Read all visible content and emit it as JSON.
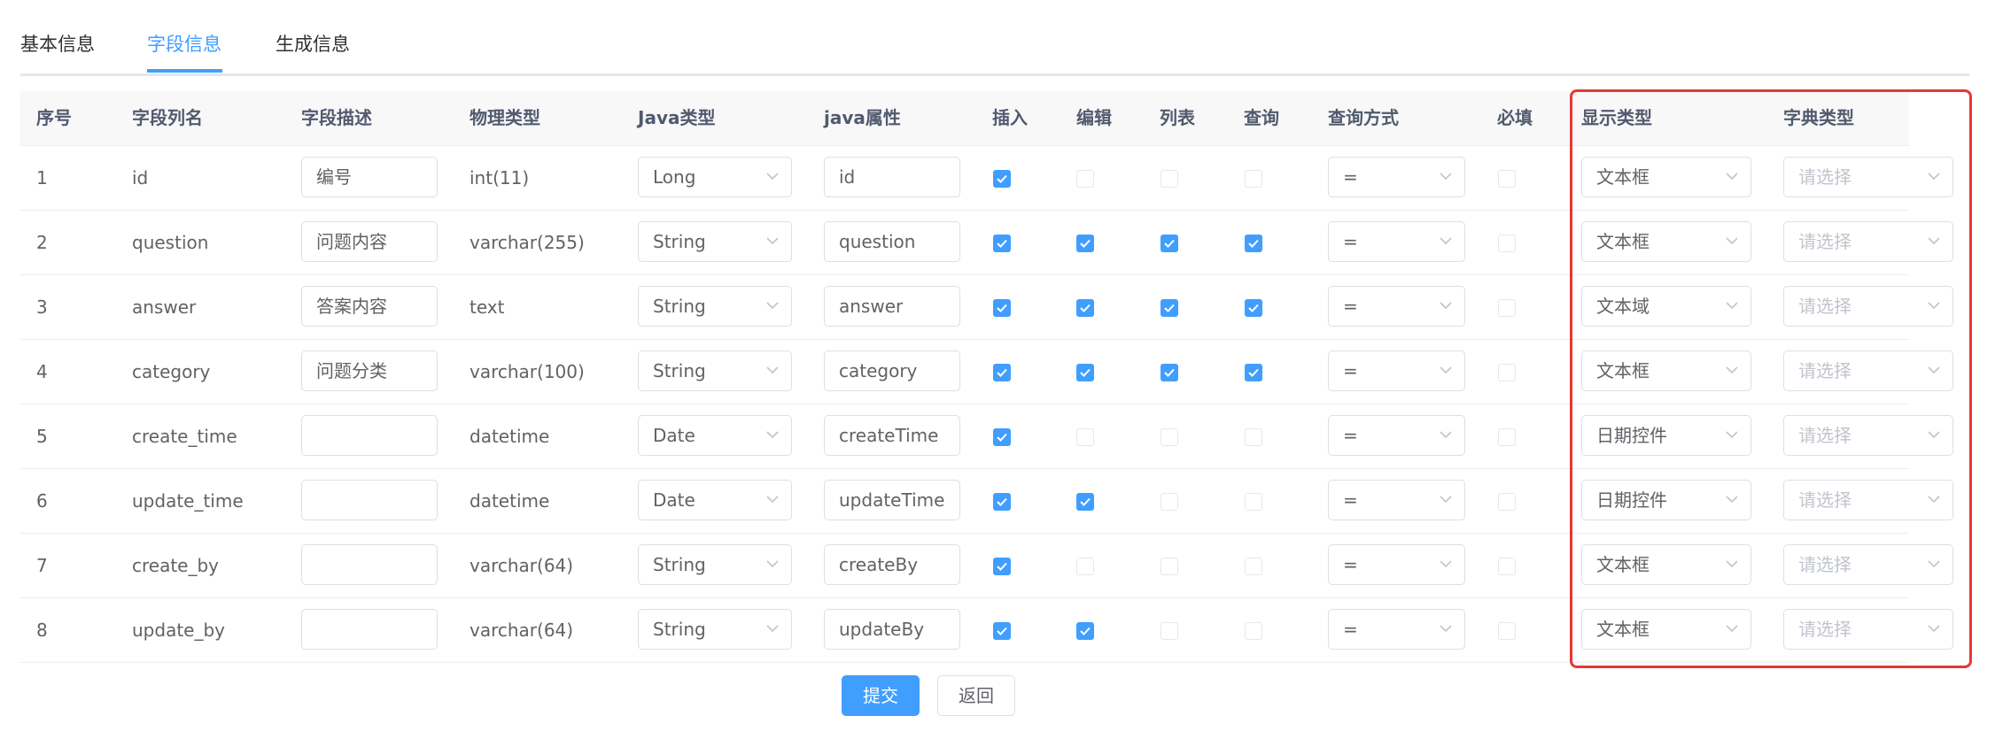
{
  "tabs": [
    {
      "label": "基本信息",
      "active": false
    },
    {
      "label": "字段信息",
      "active": true
    },
    {
      "label": "生成信息",
      "active": false
    }
  ],
  "columns": [
    "序号",
    "字段列名",
    "字段描述",
    "物理类型",
    "Java类型",
    "java属性",
    "插入",
    "编辑",
    "列表",
    "查询",
    "查询方式",
    "必填",
    "显示类型",
    "字典类型"
  ],
  "dict_placeholder": "请选择",
  "rows": [
    {
      "no": "1",
      "column": "id",
      "desc": "编号",
      "physical": "int(11)",
      "java_type": "Long",
      "java_field": "id",
      "insert": true,
      "edit": false,
      "list": false,
      "query": false,
      "query_type": "=",
      "required": false,
      "display_type": "文本框"
    },
    {
      "no": "2",
      "column": "question",
      "desc": "问题内容",
      "physical": "varchar(255)",
      "java_type": "String",
      "java_field": "question",
      "insert": true,
      "edit": true,
      "list": true,
      "query": true,
      "query_type": "=",
      "required": false,
      "display_type": "文本框"
    },
    {
      "no": "3",
      "column": "answer",
      "desc": "答案内容",
      "physical": "text",
      "java_type": "String",
      "java_field": "answer",
      "insert": true,
      "edit": true,
      "list": true,
      "query": true,
      "query_type": "=",
      "required": false,
      "display_type": "文本域"
    },
    {
      "no": "4",
      "column": "category",
      "desc": "问题分类",
      "physical": "varchar(100)",
      "java_type": "String",
      "java_field": "category",
      "insert": true,
      "edit": true,
      "list": true,
      "query": true,
      "query_type": "=",
      "required": false,
      "display_type": "文本框"
    },
    {
      "no": "5",
      "column": "create_time",
      "desc": "",
      "physical": "datetime",
      "java_type": "Date",
      "java_field": "createTime",
      "insert": true,
      "edit": false,
      "list": false,
      "query": false,
      "query_type": "=",
      "required": false,
      "display_type": "日期控件"
    },
    {
      "no": "6",
      "column": "update_time",
      "desc": "",
      "physical": "datetime",
      "java_type": "Date",
      "java_field": "updateTime",
      "insert": true,
      "edit": true,
      "list": false,
      "query": false,
      "query_type": "=",
      "required": false,
      "display_type": "日期控件"
    },
    {
      "no": "7",
      "column": "create_by",
      "desc": "",
      "physical": "varchar(64)",
      "java_type": "String",
      "java_field": "createBy",
      "insert": true,
      "edit": false,
      "list": false,
      "query": false,
      "query_type": "=",
      "required": false,
      "display_type": "文本框"
    },
    {
      "no": "8",
      "column": "update_by",
      "desc": "",
      "physical": "varchar(64)",
      "java_type": "String",
      "java_field": "updateBy",
      "insert": true,
      "edit": true,
      "list": false,
      "query": false,
      "query_type": "=",
      "required": false,
      "display_type": "文本框"
    }
  ],
  "buttons": {
    "submit": "提交",
    "back": "返回"
  },
  "colors": {
    "primary": "#409eff",
    "highlight": "#e53935",
    "border": "#dcdfe6"
  }
}
